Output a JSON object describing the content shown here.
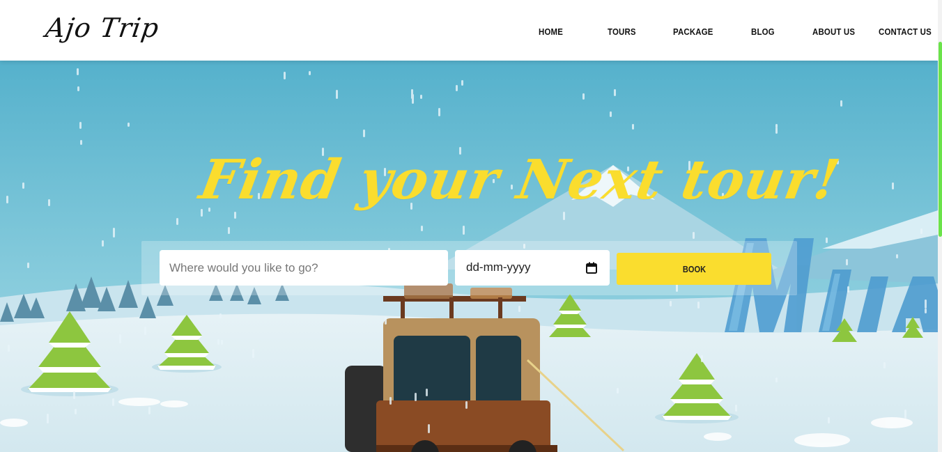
{
  "brand": {
    "logo_text": "Ajo Trip"
  },
  "nav": {
    "items": [
      {
        "label": "HOME"
      },
      {
        "label": "TOURS"
      },
      {
        "label": "PACKAGE"
      },
      {
        "label": "BLOG"
      },
      {
        "label": "ABOUT US"
      },
      {
        "label": "CONTACT US"
      }
    ]
  },
  "hero": {
    "title": "Find your Next tour!",
    "search": {
      "destination_placeholder": "Where would you like to go?",
      "date_value": "dd-mm-yyyy",
      "book_label": "BOOK"
    }
  },
  "colors": {
    "accent_yellow": "#fadd2e",
    "sky_blue": "#5ab7cf",
    "scroll_thumb": "#6be34a"
  },
  "icons": {
    "date_icon": "calendar-icon"
  }
}
